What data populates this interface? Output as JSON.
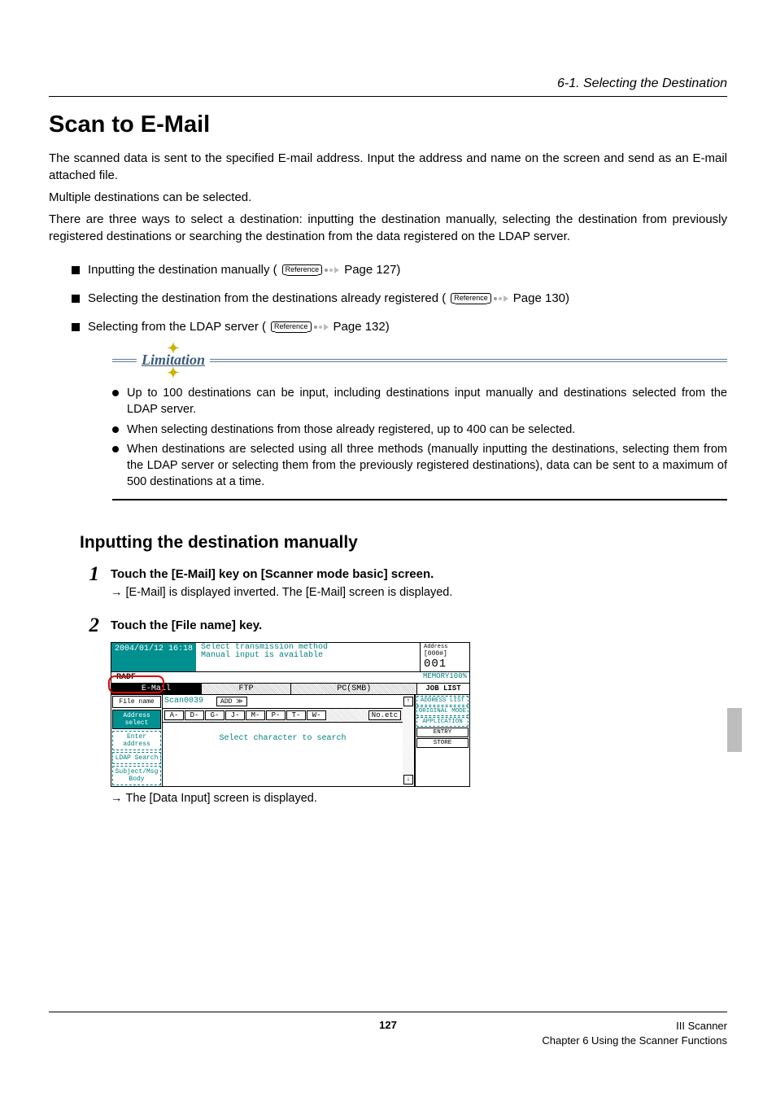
{
  "header": {
    "section_label": "6-1. Selecting the Destination"
  },
  "title": "Scan to E-Mail",
  "intro": {
    "p1": "The scanned data is sent to the specified E-mail address. Input the address and name on the screen and send as an E-mail attached file.",
    "p2": "Multiple destinations can be selected.",
    "p3": "There are three ways to select a destination: inputting the destination manually, selecting the destination from previously registered destinations or searching the destination from the data registered on the LDAP server."
  },
  "methods": {
    "ref_label": "Reference",
    "m1_pre": "Inputting the destination manually (",
    "m1_post": " Page 127)",
    "m2_pre": "Selecting the destination from the destinations already registered (",
    "m2_post": " Page 130)",
    "m3_pre": "Selecting from the LDAP server (",
    "m3_post": " Page 132)"
  },
  "limitation": {
    "label": "Limitation",
    "i1": "Up to 100 destinations can be input, including destinations input manually and destinations selected from the LDAP server.",
    "i2": "When selecting destinations from those already registered, up to 400 can be selected.",
    "i3": "When destinations are selected using all three methods (manually inputting the destinations, selecting them from the LDAP server or selecting them from the previously registered destinations), data can be sent to a maximum of 500 destinations at a time."
  },
  "subheading": "Inputting the destination manually",
  "steps": {
    "s1": {
      "num": "1",
      "title": "Touch the [E-Mail] key on [Scanner mode basic] screen.",
      "sub": "[E-Mail] is displayed inverted.  The [E-Mail] screen is displayed."
    },
    "s2": {
      "num": "2",
      "title": "Touch the [File name] key.",
      "caption": "The [Data Input] screen is displayed."
    }
  },
  "screenshot": {
    "datetime": "2004/01/12 16:18",
    "msg1": "Select transmission method",
    "msg2": "Manual input is available",
    "address_label": "Address",
    "address_count_prefix": "[000#]",
    "counter": "001",
    "radf": "RADF",
    "memory": "MEMORY100%",
    "tabs": {
      "email": "E-Mail",
      "ftp": "FTP",
      "pcsmb": "PC(SMB)",
      "joblist": "JOB LIST"
    },
    "left": {
      "filename": "File name",
      "address_select": "Address select",
      "enter_address": "Enter address",
      "ldap_search": "LDAP Search",
      "subject": "Subject/Msg Body"
    },
    "file_value": "Scan0039",
    "add": "ADD ≫",
    "alpha": [
      "A-",
      "D-",
      "G-",
      "J-",
      "M-",
      "P-",
      "T-",
      "W-"
    ],
    "noetc": "No.etc",
    "select_char": "Select character to search",
    "scroll_up": "↑",
    "scroll_down": "↓",
    "right": {
      "address_list": "ADDRESS LIST",
      "original": "ORIGINAL MODE",
      "application": "APPLICATION",
      "entry": "ENTRY",
      "store": "STORE"
    }
  },
  "footer": {
    "page": "127",
    "r1": "III Scanner",
    "r2": "Chapter 6 Using the Scanner Functions"
  }
}
